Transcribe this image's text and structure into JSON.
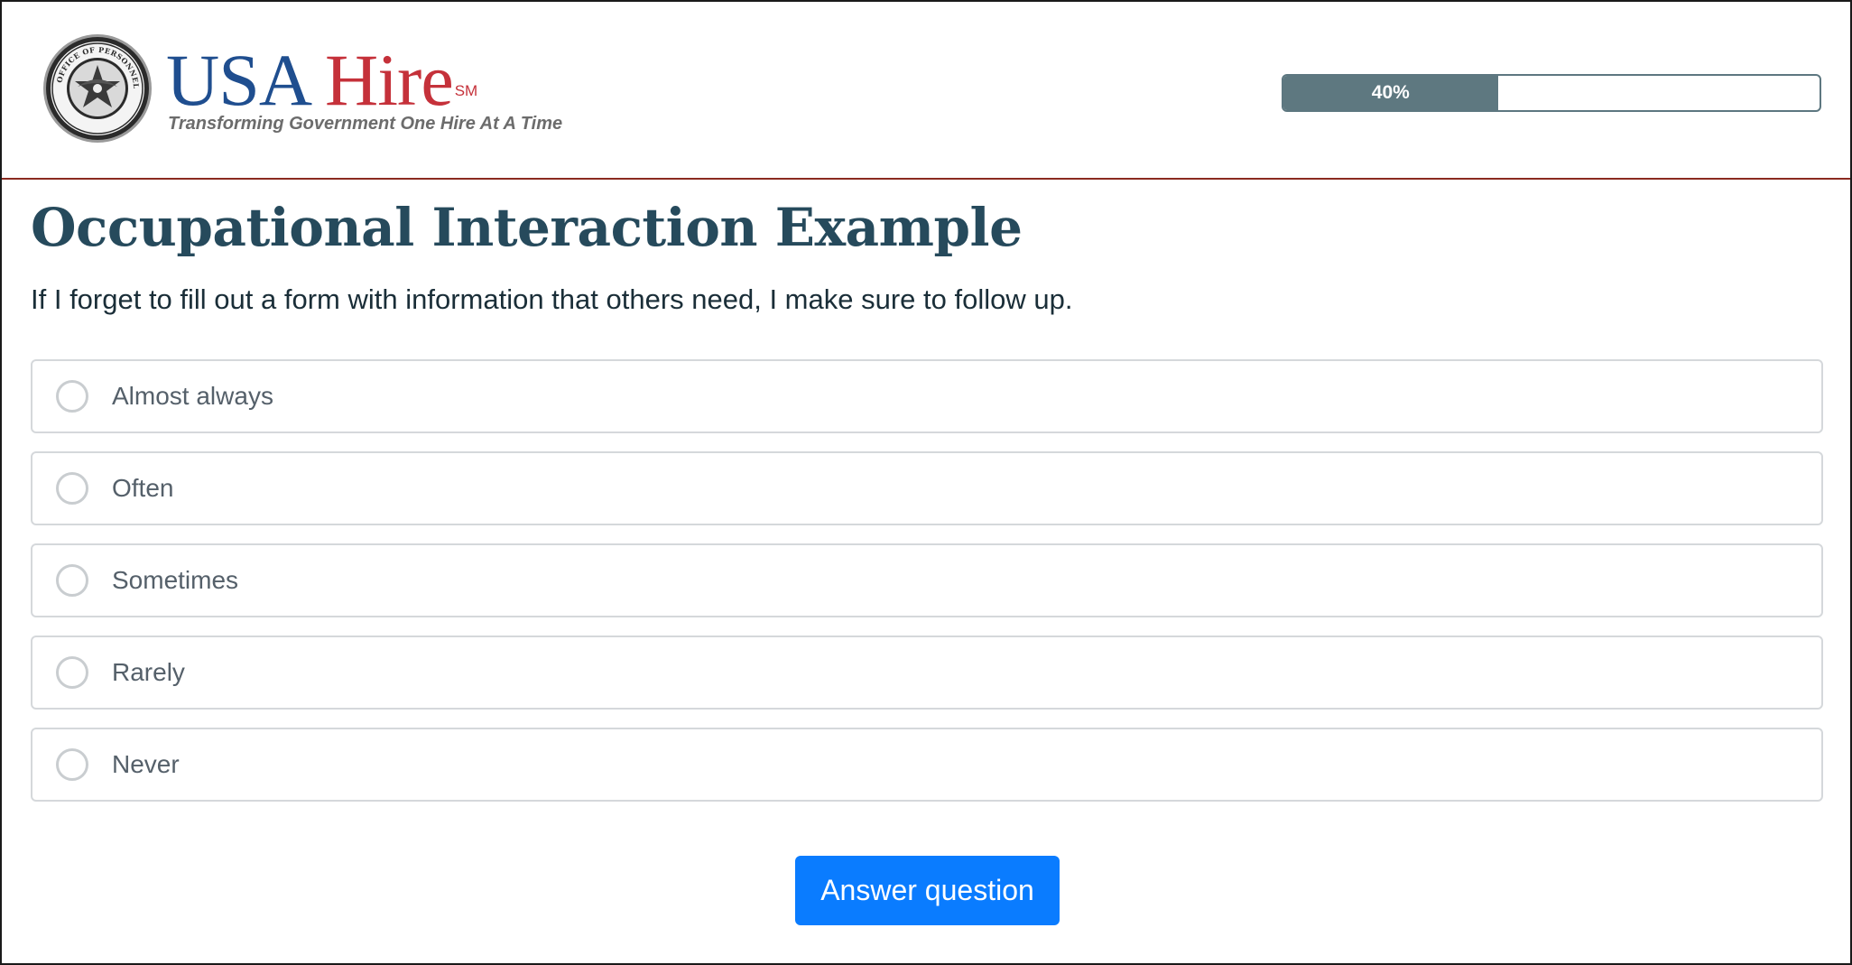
{
  "header": {
    "brand_usa": "USA",
    "brand_hire": "Hire",
    "brand_mark": "SM",
    "tagline": "Transforming Government One Hire At A Time",
    "seal_icon": "opm-seal-icon",
    "seal_text": "UNITED STATES OFFICE OF PERSONNEL MANAGEMENT"
  },
  "progress": {
    "percent": 40,
    "label": "40%",
    "fill_color": "#5e7880"
  },
  "page": {
    "title": "Occupational Interaction Example",
    "question": "If I forget to fill out a form with information that others need, I make sure to follow up."
  },
  "options": [
    {
      "label": "Almost always"
    },
    {
      "label": "Often"
    },
    {
      "label": "Sometimes"
    },
    {
      "label": "Rarely"
    },
    {
      "label": "Never"
    }
  ],
  "actions": {
    "answer_label": "Answer question",
    "answer_color": "#0a7cff"
  },
  "colors": {
    "brand_blue": "#1f4e8f",
    "brand_red": "#c5313a",
    "title": "#264a5c",
    "header_rule": "#8b2a20"
  }
}
